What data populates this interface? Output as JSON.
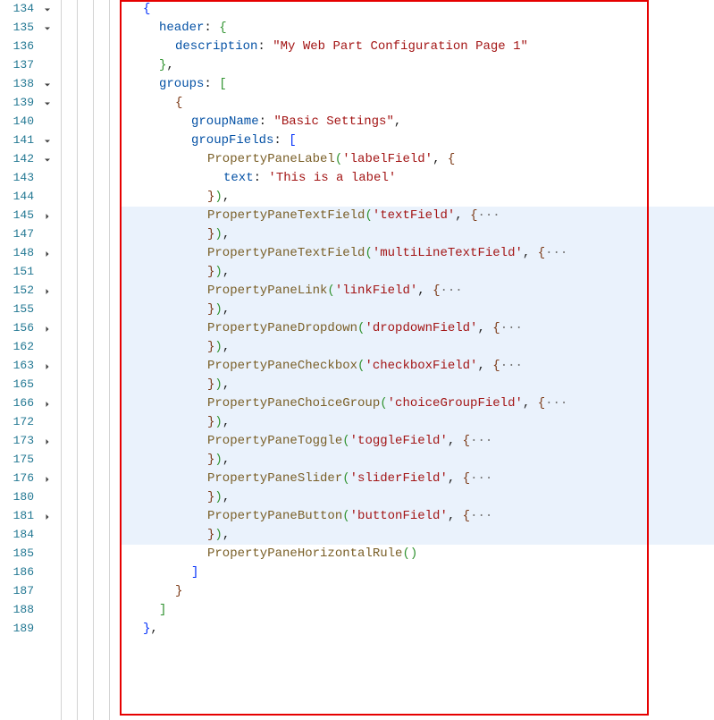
{
  "lines": [
    {
      "num": "134",
      "fold": "down"
    },
    {
      "num": "135",
      "fold": "down"
    },
    {
      "num": "136",
      "fold": ""
    },
    {
      "num": "137",
      "fold": ""
    },
    {
      "num": "138",
      "fold": "down"
    },
    {
      "num": "139",
      "fold": "down"
    },
    {
      "num": "140",
      "fold": ""
    },
    {
      "num": "141",
      "fold": "down"
    },
    {
      "num": "142",
      "fold": "down"
    },
    {
      "num": "143",
      "fold": ""
    },
    {
      "num": "144",
      "fold": ""
    },
    {
      "num": "145",
      "fold": "right",
      "hl": true
    },
    {
      "num": "147",
      "fold": "",
      "hl": true
    },
    {
      "num": "148",
      "fold": "right",
      "hl": true
    },
    {
      "num": "151",
      "fold": "",
      "hl": true
    },
    {
      "num": "152",
      "fold": "right",
      "hl": true
    },
    {
      "num": "155",
      "fold": "",
      "hl": true
    },
    {
      "num": "156",
      "fold": "right",
      "hl": true
    },
    {
      "num": "162",
      "fold": "",
      "hl": true
    },
    {
      "num": "163",
      "fold": "right",
      "hl": true
    },
    {
      "num": "165",
      "fold": "",
      "hl": true
    },
    {
      "num": "166",
      "fold": "right",
      "hl": true
    },
    {
      "num": "172",
      "fold": "",
      "hl": true
    },
    {
      "num": "173",
      "fold": "right",
      "hl": true
    },
    {
      "num": "175",
      "fold": "",
      "hl": true
    },
    {
      "num": "176",
      "fold": "right",
      "hl": true
    },
    {
      "num": "180",
      "fold": "",
      "hl": true
    },
    {
      "num": "181",
      "fold": "right",
      "hl": true
    },
    {
      "num": "184",
      "fold": "",
      "hl": true
    },
    {
      "num": "185",
      "fold": ""
    },
    {
      "num": "186",
      "fold": ""
    },
    {
      "num": "187",
      "fold": ""
    },
    {
      "num": "188",
      "fold": ""
    },
    {
      "num": "189",
      "fold": ""
    }
  ],
  "tokens": {
    "open_brace": "{",
    "close_brace": "}",
    "open_bracket": "[",
    "close_bracket": "]",
    "comma": ",",
    "colon": ":",
    "paren_open": "(",
    "paren_close": ")",
    "ellipsis": "···",
    "keys": {
      "header": "header",
      "description": "description",
      "groups": "groups",
      "groupName": "groupName",
      "groupFields": "groupFields",
      "text": "text"
    },
    "strings": {
      "desc_dq": "\"My Web Part Configuration Page 1\"",
      "basic_dq": "\"Basic Settings\"",
      "label_sq": "'labelField'",
      "thislabel_sq": "'This is a label'",
      "text_sq": "'textField'",
      "multi_sq": "'multiLineTextField'",
      "link_sq": "'linkField'",
      "dropdown_sq": "'dropdownField'",
      "checkbox_sq": "'checkboxField'",
      "choice_sq": "'choiceGroupField'",
      "toggle_sq": "'toggleField'",
      "slider_sq": "'sliderField'",
      "button_sq": "'buttonField'"
    },
    "fns": {
      "label": "PropertyPaneLabel",
      "textfield": "PropertyPaneTextField",
      "link": "PropertyPaneLink",
      "dropdown": "PropertyPaneDropdown",
      "checkbox": "PropertyPaneCheckbox",
      "choice": "PropertyPaneChoiceGroup",
      "toggle": "PropertyPaneToggle",
      "slider": "PropertyPaneSlider",
      "button": "PropertyPaneButton",
      "hrule": "PropertyPaneHorizontalRule"
    }
  }
}
